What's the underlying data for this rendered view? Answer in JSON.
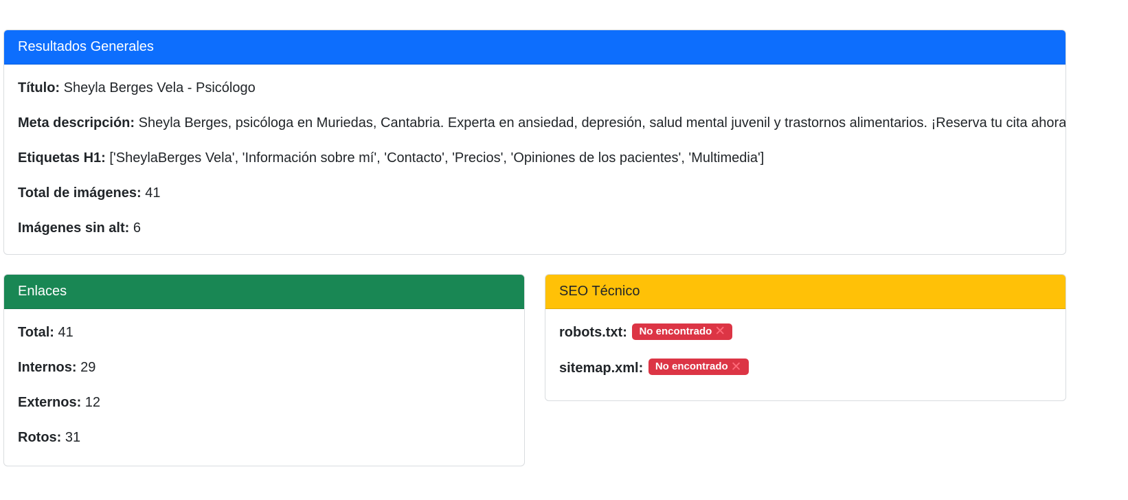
{
  "general": {
    "header": "Resultados Generales",
    "header_color": "#0d6efd",
    "rows": [
      {
        "label": "Título:",
        "value": " Sheyla Berges Vela - Psicólogo"
      },
      {
        "label": "Meta descripción:",
        "value": " Sheyla Berges, psicóloga en Muriedas, Cantabria. Experta en ansiedad, depresión, salud mental juvenil y trastornos alimentarios. ¡Reserva tu cita ahora!"
      },
      {
        "label": "Etiquetas H1:",
        "value": " ['SheylaBerges Vela', 'Información sobre mí', 'Contacto', 'Precios', 'Opiniones de los pacientes', 'Multimedia']"
      },
      {
        "label": "Total de imágenes:",
        "value": " 41"
      },
      {
        "label": "Imágenes sin alt:",
        "value": " 6"
      }
    ]
  },
  "links": {
    "header": "Enlaces",
    "header_color": "#198754",
    "rows": [
      {
        "label": "Total:",
        "value": " 41"
      },
      {
        "label": "Internos:",
        "value": " 29"
      },
      {
        "label": "Externos:",
        "value": " 12"
      },
      {
        "label": "Rotos:",
        "value": " 31"
      }
    ]
  },
  "seo": {
    "header": "SEO Técnico",
    "header_color": "#ffc107",
    "rows": [
      {
        "label": "robots.txt:",
        "badge": "No encontrado",
        "badge_icon": "x-icon"
      },
      {
        "label": "sitemap.xml:",
        "badge": "No encontrado",
        "badge_icon": "x-icon"
      }
    ],
    "badge_color": "#dc3545"
  }
}
